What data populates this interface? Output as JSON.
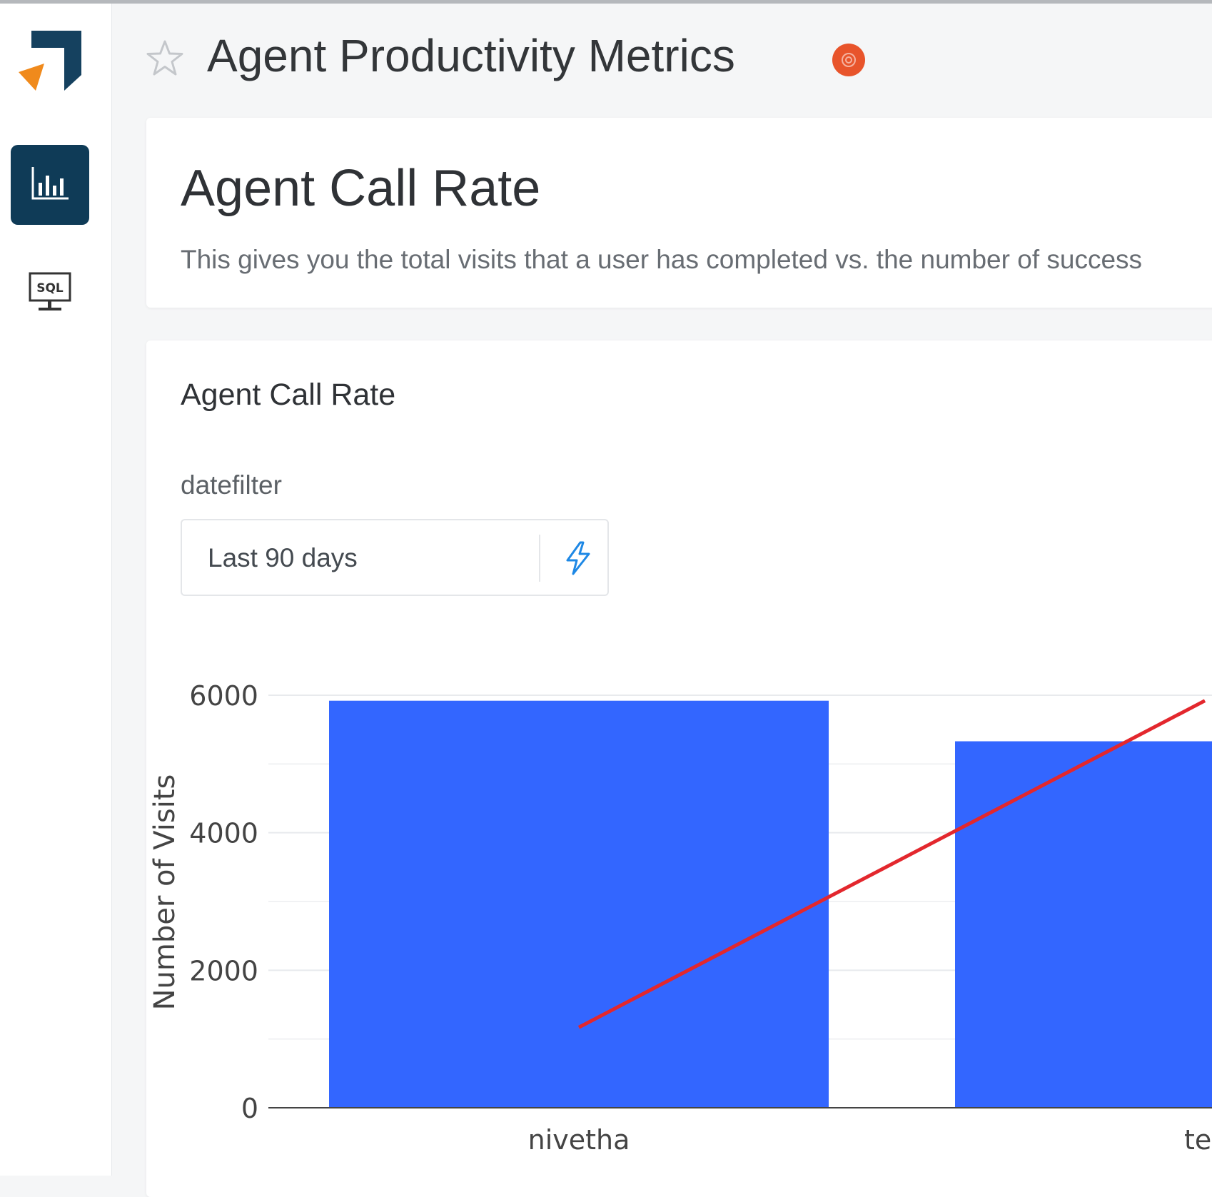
{
  "app": {
    "page_title": "Agent Productivity Metrics",
    "favorite_icon": "star-outline-icon",
    "status_icon": "status-badge-icon",
    "status_color": "#e8542b"
  },
  "sidebar": {
    "logo_icon": "app-logo-icon",
    "items": [
      {
        "icon": "bar-chart-icon",
        "active": true
      },
      {
        "icon": "sql-monitor-icon",
        "active": false
      }
    ],
    "active_color": "#0f3b57"
  },
  "dashboard": {
    "title": "Agent Call Rate",
    "description": "This gives you the total visits that a user has completed vs. the number of success"
  },
  "widget": {
    "title": "Agent Call Rate",
    "filter": {
      "label": "datefilter",
      "value": "Last 90 days",
      "action_icon": "lightning-bolt-icon"
    }
  },
  "chart_data": {
    "type": "bar",
    "ylabel": "Number of Visits",
    "yticks": [
      "0",
      "2000",
      "4000",
      "6000"
    ],
    "ylim": [
      0,
      6000
    ],
    "categories": [
      "nivetha",
      "tes"
    ],
    "series": [
      {
        "type": "bar",
        "values": [
          5920,
          5330
        ],
        "color": "#3366ff"
      },
      {
        "type": "line",
        "values": [
          1170,
          5920
        ],
        "color": "#e3272d"
      }
    ],
    "grid": true
  }
}
